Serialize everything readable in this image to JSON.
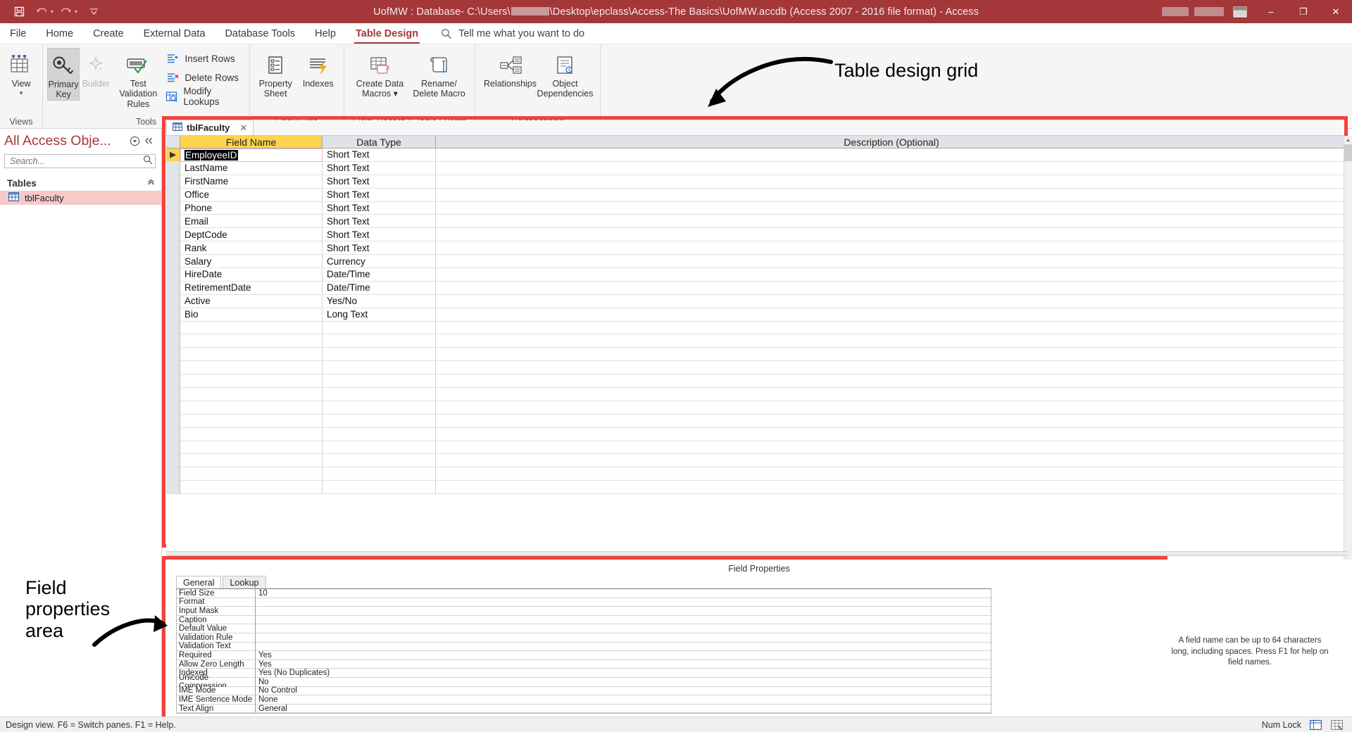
{
  "titlebar": {
    "save_icon": "save-icon",
    "undo_icon": "undo-icon",
    "redo_icon": "redo-icon",
    "customize_icon": "customize-quick-access-icon",
    "title_prefix": "UofMW : Database- C:\\Users\\",
    "title_suffix": "\\Desktop\\epclass\\Access-The Basics\\UofMW.accdb (Access 2007 - 2016 file format)  -  Access",
    "minimize": "–",
    "restore": "❐",
    "close": "✕"
  },
  "tabs": [
    {
      "label": "File",
      "active": false
    },
    {
      "label": "Home",
      "active": false
    },
    {
      "label": "Create",
      "active": false
    },
    {
      "label": "External Data",
      "active": false
    },
    {
      "label": "Database Tools",
      "active": false
    },
    {
      "label": "Help",
      "active": false
    },
    {
      "label": "Table Design",
      "active": true
    }
  ],
  "tellme": {
    "icon": "search-icon",
    "placeholder": "Tell me what you want to do"
  },
  "ribbon": {
    "groups": [
      {
        "label": "Views",
        "buttons": [
          {
            "name": "view-button",
            "label": "View",
            "icon": "table-view-icon",
            "caret": "⌄",
            "state": "normal"
          }
        ]
      },
      {
        "label": "Tools",
        "buttons": [
          {
            "name": "primary-key-button",
            "label": "Primary\nKey",
            "icon": "key-icon",
            "state": "selected"
          },
          {
            "name": "builder-button",
            "label": "Builder",
            "icon": "wand-icon",
            "state": "disabled"
          },
          {
            "name": "test-validation-rules-button",
            "label": "Test Validation\nRules",
            "icon": "validation-icon",
            "state": "normal"
          }
        ],
        "small_buttons": [
          {
            "name": "insert-rows-button",
            "label": "Insert Rows",
            "icon": "insert-rows-icon"
          },
          {
            "name": "delete-rows-button",
            "label": "Delete Rows",
            "icon": "delete-rows-icon"
          },
          {
            "name": "modify-lookups-button",
            "label": "Modify Lookups",
            "icon": "modify-lookups-icon"
          }
        ]
      },
      {
        "label": "Show/Hide",
        "buttons": [
          {
            "name": "property-sheet-button",
            "label": "Property\nSheet",
            "icon": "property-sheet-icon",
            "state": "normal"
          },
          {
            "name": "indexes-button",
            "label": "Indexes",
            "icon": "indexes-icon",
            "state": "normal"
          }
        ]
      },
      {
        "label": "Field, Record & Table Events",
        "buttons": [
          {
            "name": "create-data-macros-button",
            "label": "Create Data\nMacros ⌄",
            "icon": "create-data-macros-icon",
            "state": "normal"
          },
          {
            "name": "rename-delete-macro-button",
            "label": "Rename/\nDelete Macro",
            "icon": "rename-delete-macro-icon",
            "state": "normal"
          }
        ]
      },
      {
        "label": "Relationships",
        "buttons": [
          {
            "name": "relationships-button",
            "label": "Relationships",
            "icon": "relationships-icon",
            "state": "normal"
          },
          {
            "name": "object-dependencies-button",
            "label": "Object\nDependencies",
            "icon": "object-dependencies-icon",
            "state": "normal"
          }
        ]
      }
    ]
  },
  "navpane": {
    "title": "All Access Obje...",
    "menu_icon": "dropdown-circle-icon",
    "collapse_icon": "double-chevron-left-icon",
    "search": {
      "value": "",
      "placeholder": "Search...",
      "icon": "search-icon"
    },
    "group": {
      "label": "Tables",
      "chevron": "«"
    },
    "items": [
      {
        "label": "tblFaculty",
        "icon": "table-icon",
        "selected": true
      }
    ]
  },
  "document": {
    "tab": {
      "label": "tblFaculty",
      "icon": "table-icon",
      "close": "✕"
    }
  },
  "grid": {
    "columns": [
      "Field Name",
      "Data Type",
      "Description (Optional)"
    ],
    "rows": [
      {
        "name": "EmployeeID",
        "type": "Short Text",
        "description": "",
        "current": true
      },
      {
        "name": "LastName",
        "type": "Short Text",
        "description": "",
        "current": false
      },
      {
        "name": "FirstName",
        "type": "Short Text",
        "description": "",
        "current": false
      },
      {
        "name": "Office",
        "type": "Short Text",
        "description": "",
        "current": false
      },
      {
        "name": "Phone",
        "type": "Short Text",
        "description": "",
        "current": false
      },
      {
        "name": "Email",
        "type": "Short Text",
        "description": "",
        "current": false
      },
      {
        "name": "DeptCode",
        "type": "Short Text",
        "description": "",
        "current": false
      },
      {
        "name": "Rank",
        "type": "Short Text",
        "description": "",
        "current": false
      },
      {
        "name": "Salary",
        "type": "Currency",
        "description": "",
        "current": false
      },
      {
        "name": "HireDate",
        "type": "Date/Time",
        "description": "",
        "current": false
      },
      {
        "name": "RetirementDate",
        "type": "Date/Time",
        "description": "",
        "current": false
      },
      {
        "name": "Active",
        "type": "Yes/No",
        "description": "",
        "current": false
      },
      {
        "name": "Bio",
        "type": "Long Text",
        "description": "",
        "current": false
      }
    ],
    "empty_rows": 13
  },
  "field_properties": {
    "title": "Field Properties",
    "tabs": [
      {
        "label": "General",
        "active": true
      },
      {
        "label": "Lookup",
        "active": false
      }
    ],
    "rows": [
      {
        "key": "Field Size",
        "value": "10"
      },
      {
        "key": "Format",
        "value": ""
      },
      {
        "key": "Input Mask",
        "value": ""
      },
      {
        "key": "Caption",
        "value": ""
      },
      {
        "key": "Default Value",
        "value": ""
      },
      {
        "key": "Validation Rule",
        "value": ""
      },
      {
        "key": "Validation Text",
        "value": ""
      },
      {
        "key": "Required",
        "value": "Yes"
      },
      {
        "key": "Allow Zero Length",
        "value": "Yes"
      },
      {
        "key": "Indexed",
        "value": "Yes (No Duplicates)"
      },
      {
        "key": "Unicode Compression",
        "value": "No"
      },
      {
        "key": "IME Mode",
        "value": "No Control"
      },
      {
        "key": "IME Sentence Mode",
        "value": "None"
      },
      {
        "key": "Text Align",
        "value": "General"
      }
    ],
    "help_text": "A field name can be up to 64 characters long, including spaces. Press F1 for help on field names."
  },
  "annotations": [
    {
      "name": "annotation-table-design-grid",
      "text": "Table design grid"
    },
    {
      "name": "annotation-field-properties-area",
      "text": "Field\nproperties\narea"
    }
  ],
  "statusbar": {
    "left": "Design view.  F6 = Switch panes.  F1 = Help.",
    "numlock": "Num Lock",
    "view_design_icon": "design-view-icon",
    "view_datasheet_icon": "datasheet-view-icon"
  },
  "colors": {
    "accent": "#a4373a",
    "highlight_red": "#f4413c",
    "field_name_header": "#ffd34e",
    "nav_item_selected": "#f7c9c9"
  }
}
